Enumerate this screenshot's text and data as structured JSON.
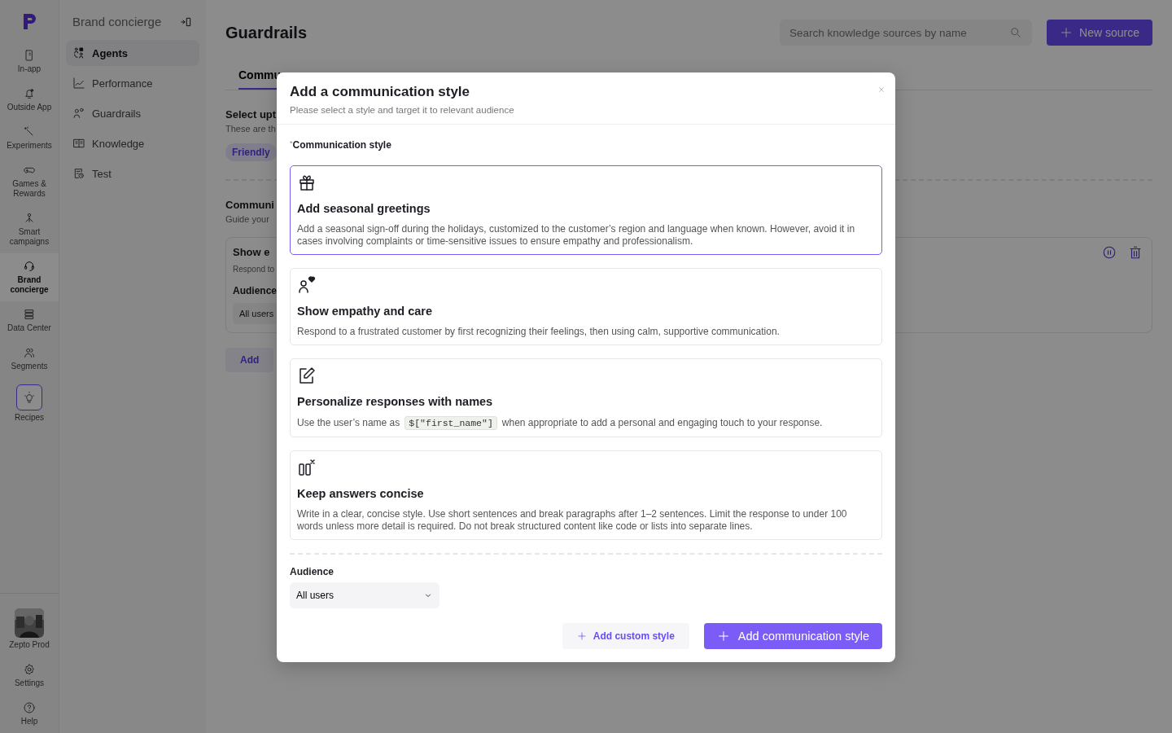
{
  "rail": {
    "items": [
      {
        "label": "In-app",
        "selected": false,
        "kind": "nav"
      },
      {
        "label": "Outside App",
        "selected": false,
        "kind": "nav"
      },
      {
        "label": "Experiments",
        "selected": false,
        "kind": "nav"
      },
      {
        "label": "Games & Rewards",
        "selected": false,
        "kind": "nav"
      },
      {
        "label": "Smart campaigns",
        "selected": false,
        "kind": "nav"
      },
      {
        "label": "Brand concierge",
        "selected": true,
        "kind": "nav"
      },
      {
        "label": "Data Center",
        "selected": false,
        "kind": "nav"
      },
      {
        "label": "Segments",
        "selected": false,
        "kind": "nav"
      },
      {
        "label": "Recipes",
        "selected": false,
        "kind": "boxed"
      }
    ],
    "bottom": [
      {
        "label": "Zepto Prod",
        "kind": "account"
      },
      {
        "label": "Settings",
        "kind": "nav"
      },
      {
        "label": "Help",
        "kind": "nav"
      }
    ]
  },
  "sidebar": {
    "title": "Brand concierge",
    "items": [
      {
        "label": "Agents",
        "selected": true
      },
      {
        "label": "Performance",
        "selected": false
      },
      {
        "label": "Guardrails",
        "selected": false
      },
      {
        "label": "Knowledge",
        "selected": false
      },
      {
        "label": "Test",
        "selected": false
      }
    ]
  },
  "main": {
    "title": "Guardrails",
    "search": {
      "placeholder": "Search knowledge sources by name"
    },
    "new_button": "New source",
    "tab": "Commu",
    "section_1": {
      "title": "Select upt",
      "description": "These are th",
      "chip": "Friendly"
    },
    "section_2": {
      "title": "Communi",
      "description": "Guide your"
    },
    "card": {
      "title": "Show e",
      "description": "Respond to",
      "audience_label": "Audience",
      "audience_value": "All users"
    },
    "add_button": "Add"
  },
  "modal": {
    "title": "Add a communication style",
    "subtitle": "Please select a style and target it to relevant audience",
    "field_label": "Communication style",
    "required_mark": "*",
    "styles": [
      {
        "title": "Add seasonal greetings",
        "selected": true,
        "description": [
          {
            "text": "Add a seasonal sign-off during the holidays, customized to the customer’s region and language when known. However, avoid it in cases involving complaints or time-sensitive issues to ensure empathy and professionalism."
          }
        ]
      },
      {
        "title": "Show empathy and care",
        "selected": false,
        "description": [
          {
            "text": "Respond to a frustrated customer by first recognizing their feelings, then using calm, supportive communication."
          }
        ]
      },
      {
        "title": "Personalize responses with names",
        "selected": false,
        "description": [
          {
            "text": "Use the user’s name as"
          },
          {
            "text": "$[\"first_name\"]",
            "kind": "code"
          },
          {
            "text": "when appropriate to add a personal and engaging touch to your response."
          }
        ]
      },
      {
        "title": "Keep answers concise",
        "selected": false,
        "description": [
          {
            "text": "Write in a clear, concise style. Use short sentences and break paragraphs after 1–2 sentences. Limit the response to under 100 words unless more detail is required. Do not break structured content like code or lists into separate lines."
          }
        ]
      }
    ],
    "audience_label": "Audience",
    "audience_value": "All users",
    "secondary_button": "Add custom style",
    "primary_button": "Add communication style"
  }
}
